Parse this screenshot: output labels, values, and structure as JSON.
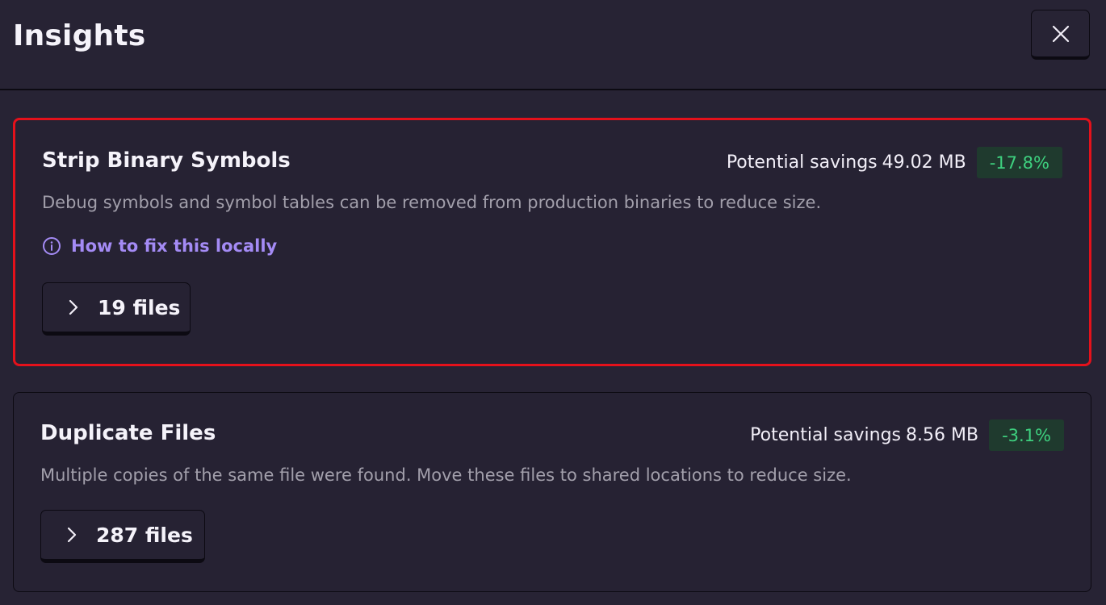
{
  "header": {
    "title": "Insights",
    "close_icon": "close-icon"
  },
  "insights": [
    {
      "title": "Strip Binary Symbols",
      "description": "Debug symbols and symbol tables can be removed from production binaries to reduce size.",
      "savings_label": "Potential savings",
      "savings_value": "49.02 MB",
      "savings_percent": "-17.8%",
      "fix_link_label": "How to fix this locally",
      "files_label": "19 files",
      "selected": true
    },
    {
      "title": "Duplicate Files",
      "description": "Multiple copies of the same file were found. Move these files to shared locations to reduce size.",
      "savings_label": "Potential savings",
      "savings_value": "8.56 MB",
      "savings_percent": "-3.1%",
      "files_label": "287 files",
      "selected": false
    }
  ],
  "colors": {
    "background": "#272334",
    "selected_border": "#e4111b",
    "badge_background": "#1f3a2e",
    "badge_text": "#3ed17f",
    "link": "#a48bf5"
  }
}
